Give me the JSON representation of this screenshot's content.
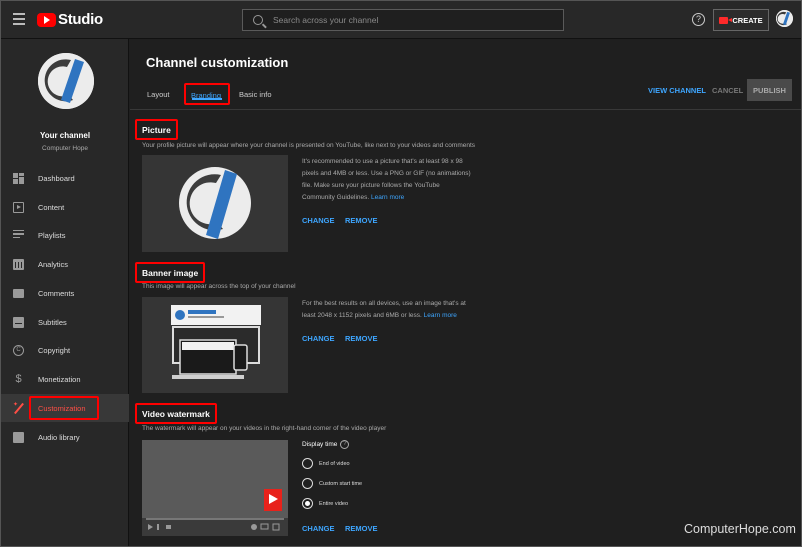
{
  "app": {
    "title": "Studio"
  },
  "search": {
    "placeholder": "Search across your channel"
  },
  "header": {
    "help_icon": "help-icon",
    "create_label": "CREATE",
    "create_icon": "video-camera-icon"
  },
  "channel": {
    "name": "Your channel",
    "owner": "Computer Hope"
  },
  "sidebar": {
    "items": [
      {
        "label": "Dashboard",
        "icon": "dashboard-icon"
      },
      {
        "label": "Content",
        "icon": "content-icon"
      },
      {
        "label": "Playlists",
        "icon": "playlists-icon"
      },
      {
        "label": "Analytics",
        "icon": "analytics-icon"
      },
      {
        "label": "Comments",
        "icon": "comments-icon"
      },
      {
        "label": "Subtitles",
        "icon": "subtitles-icon"
      },
      {
        "label": "Copyright",
        "icon": "copyright-icon"
      },
      {
        "label": "Monetization",
        "icon": "dollar-icon"
      },
      {
        "label": "Customization",
        "icon": "magic-wand-icon",
        "active": true
      },
      {
        "label": "Audio library",
        "icon": "audio-library-icon"
      }
    ]
  },
  "page": {
    "title": "Channel customization",
    "tabs": [
      {
        "label": "Layout"
      },
      {
        "label": "Branding",
        "active": true
      },
      {
        "label": "Basic info"
      }
    ],
    "view_channel": "VIEW CHANNEL",
    "cancel": "CANCEL",
    "publish": "PUBLISH"
  },
  "picture": {
    "heading": "Picture",
    "description": "Your profile picture will appear where your channel is presented on YouTube, like next to your videos and comments",
    "info": "It's recommended to use a picture that's at least 98 x 98 pixels and 4MB or less. Use a PNG or GIF (no animations) file. Make sure your picture follows the YouTube Community Guidelines.",
    "learn_more": "Learn more",
    "change": "CHANGE",
    "remove": "REMOVE"
  },
  "banner": {
    "heading": "Banner image",
    "description": "This image will appear across the top of your channel",
    "info": "For the best results on all devices, use an image that's at least 2048 x 1152 pixels and 6MB or less.",
    "learn_more": "Learn more",
    "change": "CHANGE",
    "remove": "REMOVE"
  },
  "watermark": {
    "heading": "Video watermark",
    "description": "The watermark will appear on your videos in the right-hand corner of the video player",
    "display_time_label": "Display time",
    "options": [
      {
        "label": "End of video",
        "selected": false
      },
      {
        "label": "Custom start time",
        "selected": false
      },
      {
        "label": "Entire video",
        "selected": true
      }
    ],
    "change": "CHANGE",
    "remove": "REMOVE"
  },
  "credit": "ComputerHope.com",
  "colors": {
    "accent_blue": "#3ea6ff",
    "brand_red": "#ff0000",
    "highlight_box": "#ff0000"
  }
}
